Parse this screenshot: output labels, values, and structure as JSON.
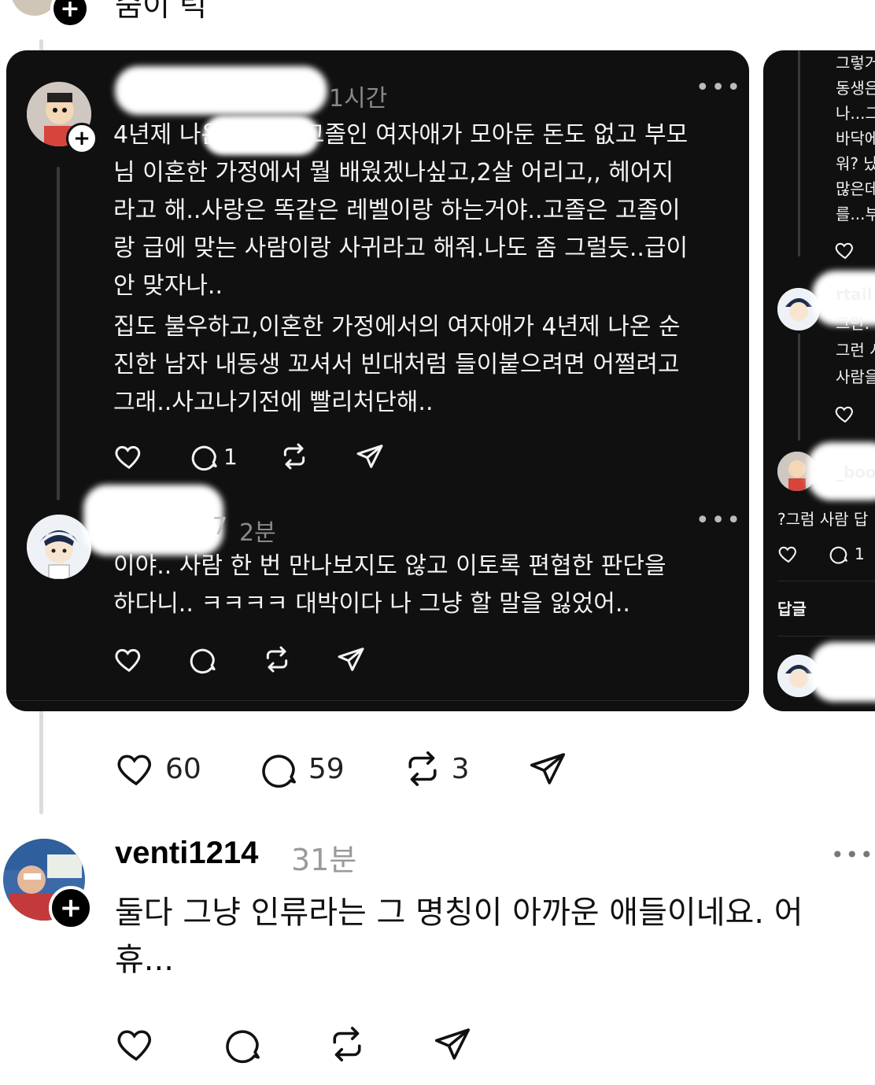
{
  "top": {
    "partial_text": "숨이 턱"
  },
  "card_main": {
    "post1": {
      "time": "1시간",
      "paragraph1": "4년제 나온 집에서 고졸인 여자애가 모아둔 돈도 없고 부모님 이혼한 가정에서 뭘 배웠겠나싶고,2살 어리고,, 헤어지라고 해..사랑은 똑같은 레벨이랑 하는거야..고졸은 고졸이랑 급에 맞는 사람이랑 사귀라고 해줘.나도 좀 그럴듯..급이 안 맞자나..",
      "paragraph1_lines": [
        "4년제 나온 집에서 고졸인 여자애가 모아둔 돈도 없고 부모",
        "님 이혼한 가정에서 뭘 배웠겠나싶고,2살 어리고,, 헤어지",
        "라고 해..사랑은 똑같은 레벨이랑 하는거야..고졸은 고졸이",
        "랑 급에 맞는 사람이랑 사귀라고 해줘.나도 좀 그럴듯..급이",
        "안 맞자나.."
      ],
      "paragraph2_lines": [
        "집도 불우하고,이혼한 가정에서의 여자애가 4년제 나온 순",
        "진한 남자 내동생 꼬셔서 빈대처럼 들이붙으려면 어쩔려고",
        "그래..사고나기전에 빨리처단해.."
      ],
      "reply_count": "1"
    },
    "post2": {
      "username_tail": "7",
      "time": "2분",
      "lines": [
        "이야.. 사람 한 번 만나보지도 않고 이토록 편협한 판단을",
        "하다니.. ㅋㅋㅋㅋ 대박이다 나 그냥 할 말을 잃었어.."
      ]
    }
  },
  "card_side": {
    "lines_top": [
      "그렇거",
      "동생은",
      "나...그",
      "바닥에",
      "워? 났",
      "많은데",
      "를...부"
    ],
    "user2_name": "rtail1",
    "user2_lines": [
      "그만.",
      "그런 시",
      "사람을"
    ],
    "user3_name": "_boo",
    "user3_text": "?그럼 사람 답",
    "user3_reply_count": "1",
    "reply_label": "답글"
  },
  "post_actions": {
    "likes": "60",
    "comments": "59",
    "reposts": "3"
  },
  "comment": {
    "username": "venti1214",
    "time": "31분",
    "text_lines": [
      "둘다 그냥 인류라는 그 명칭이 아까운 애들이네요. 어",
      "휴..."
    ]
  },
  "icons": {
    "heart": "heart-icon",
    "comment": "comment-icon",
    "repost": "repost-icon",
    "share": "send-icon",
    "more": "more-icon",
    "plus": "plus-icon"
  }
}
